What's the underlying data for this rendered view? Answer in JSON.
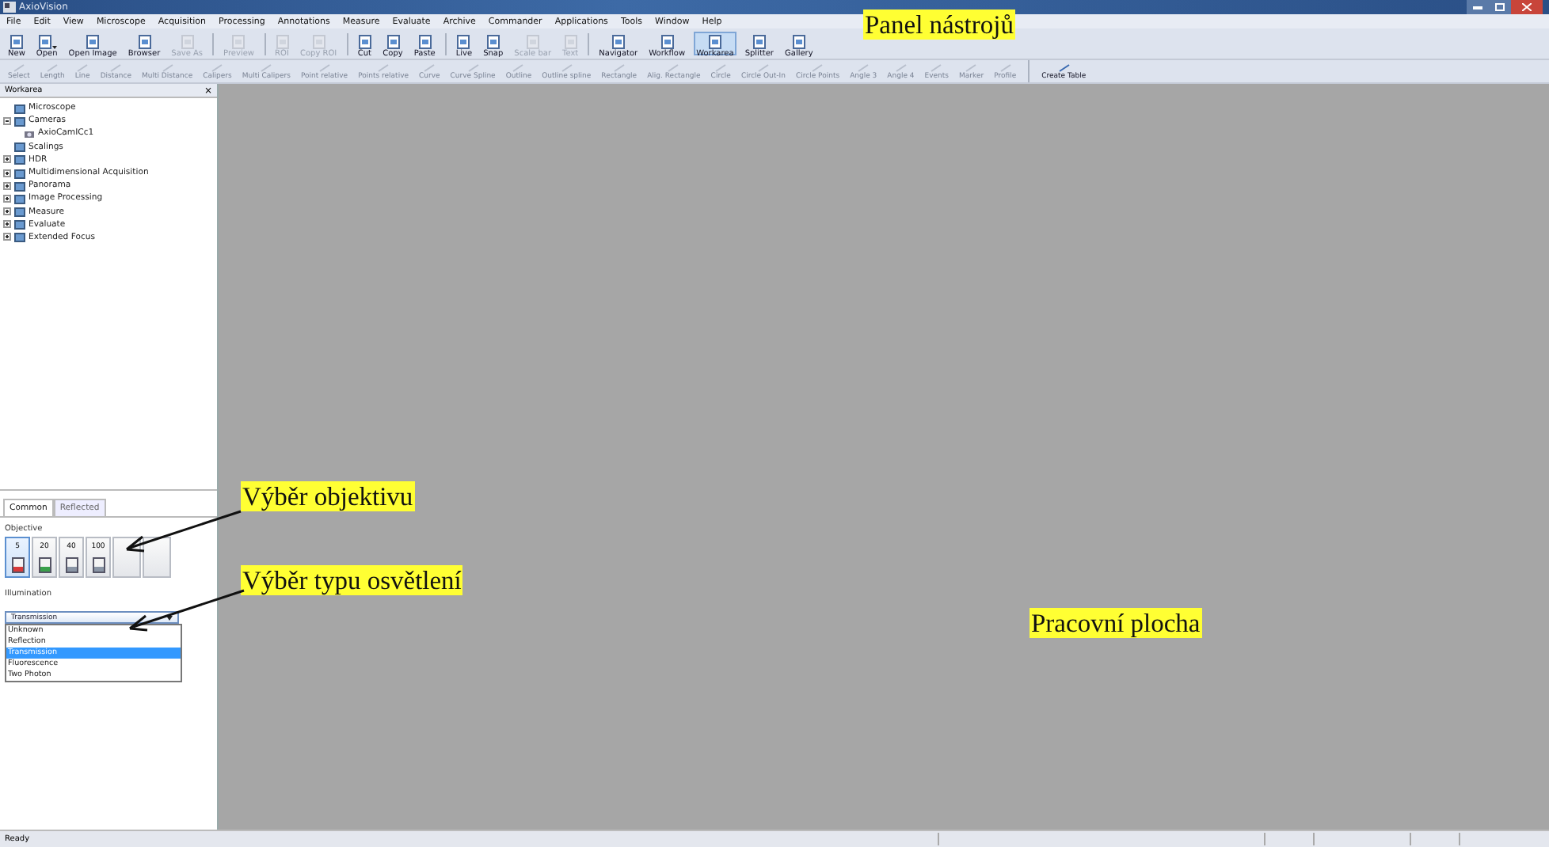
{
  "window": {
    "title": "AxioVision"
  },
  "menu": [
    "File",
    "Edit",
    "View",
    "Microscope",
    "Acquisition",
    "Processing",
    "Annotations",
    "Measure",
    "Evaluate",
    "Archive",
    "Commander",
    "Applications",
    "Tools",
    "Window",
    "Help"
  ],
  "toolbar": [
    {
      "kind": "button",
      "label": "New",
      "disabled": false,
      "selected": false
    },
    {
      "kind": "button",
      "label": "Open",
      "disabled": false,
      "selected": false,
      "dropdown": true
    },
    {
      "kind": "button",
      "label": "Open Image",
      "disabled": false,
      "selected": false
    },
    {
      "kind": "button",
      "label": "Browser",
      "disabled": false,
      "selected": false
    },
    {
      "kind": "button",
      "label": "Save As",
      "disabled": true,
      "selected": false
    },
    {
      "kind": "separator"
    },
    {
      "kind": "button",
      "label": "Preview",
      "disabled": true,
      "selected": false
    },
    {
      "kind": "separator"
    },
    {
      "kind": "button",
      "label": "ROI",
      "disabled": true,
      "selected": false
    },
    {
      "kind": "button",
      "label": "Copy ROI",
      "disabled": true,
      "selected": false
    },
    {
      "kind": "separator"
    },
    {
      "kind": "button",
      "label": "Cut",
      "disabled": false,
      "selected": false
    },
    {
      "kind": "button",
      "label": "Copy",
      "disabled": false,
      "selected": false
    },
    {
      "kind": "button",
      "label": "Paste",
      "disabled": false,
      "selected": false
    },
    {
      "kind": "separator"
    },
    {
      "kind": "button",
      "label": "Live",
      "disabled": false,
      "selected": false
    },
    {
      "kind": "button",
      "label": "Snap",
      "disabled": false,
      "selected": false
    },
    {
      "kind": "button",
      "label": "Scale bar",
      "disabled": true,
      "selected": false
    },
    {
      "kind": "button",
      "label": "Text",
      "disabled": true,
      "selected": false
    },
    {
      "kind": "separator"
    },
    {
      "kind": "button",
      "label": "Navigator",
      "disabled": false,
      "selected": false
    },
    {
      "kind": "button",
      "label": "Workflow",
      "disabled": false,
      "selected": false
    },
    {
      "kind": "button",
      "label": "Workarea",
      "disabled": false,
      "selected": true
    },
    {
      "kind": "button",
      "label": "Splitter",
      "disabled": false,
      "selected": false
    },
    {
      "kind": "button",
      "label": "Gallery",
      "disabled": false,
      "selected": false
    }
  ],
  "measure_toolbar": [
    {
      "kind": "button",
      "label": "Select",
      "disabled": true
    },
    {
      "kind": "button",
      "label": "Length",
      "disabled": true
    },
    {
      "kind": "button",
      "label": "Line",
      "disabled": true
    },
    {
      "kind": "button",
      "label": "Distance",
      "disabled": true
    },
    {
      "kind": "button",
      "label": "Multi Distance",
      "disabled": true
    },
    {
      "kind": "button",
      "label": "Calipers",
      "disabled": true
    },
    {
      "kind": "button",
      "label": "Multi Calipers",
      "disabled": true
    },
    {
      "kind": "button",
      "label": "Point relative",
      "disabled": true
    },
    {
      "kind": "button",
      "label": "Points relative",
      "disabled": true
    },
    {
      "kind": "button",
      "label": "Curve",
      "disabled": true
    },
    {
      "kind": "button",
      "label": "Curve Spline",
      "disabled": true
    },
    {
      "kind": "button",
      "label": "Outline",
      "disabled": true
    },
    {
      "kind": "button",
      "label": "Outline spline",
      "disabled": true
    },
    {
      "kind": "button",
      "label": "Rectangle",
      "disabled": true
    },
    {
      "kind": "button",
      "label": "Alig. Rectangle",
      "disabled": true
    },
    {
      "kind": "button",
      "label": "Circle",
      "disabled": true
    },
    {
      "kind": "button",
      "label": "Circle Out-In",
      "disabled": true
    },
    {
      "kind": "button",
      "label": "Circle Points",
      "disabled": true
    },
    {
      "kind": "button",
      "label": "Angle 3",
      "disabled": true
    },
    {
      "kind": "button",
      "label": "Angle 4",
      "disabled": true
    },
    {
      "kind": "button",
      "label": "Events",
      "disabled": true
    },
    {
      "kind": "button",
      "label": "Marker",
      "disabled": true
    },
    {
      "kind": "button",
      "label": "Profile",
      "disabled": true
    },
    {
      "kind": "separator"
    },
    {
      "kind": "button",
      "label": "Create Table",
      "disabled": false
    }
  ],
  "workarea": {
    "title": "Workarea",
    "close": "×",
    "tree": [
      {
        "label": "Microscope"
      },
      {
        "label": "Cameras",
        "expanded": true,
        "children": [
          {
            "label": "AxioCamICc1"
          }
        ]
      },
      {
        "label": "Scalings"
      },
      {
        "label": "HDR",
        "expanded": false
      },
      {
        "label": "Multidimensional Acquisition",
        "expanded": false
      },
      {
        "label": "Panorama",
        "expanded": false
      },
      {
        "label": "Image Processing",
        "expanded": false
      },
      {
        "label": "Measure",
        "expanded": false
      },
      {
        "label": "Evaluate",
        "expanded": false
      },
      {
        "label": "Extended Focus",
        "expanded": false
      }
    ],
    "tabs": [
      {
        "label": "Common",
        "selected": true
      },
      {
        "label": "Reflected",
        "selected": false
      }
    ],
    "objective": {
      "label": "Objective",
      "buttons": [
        {
          "kind": "lens",
          "label": "5",
          "selected": true,
          "color": "#d83a3a"
        },
        {
          "kind": "lens",
          "label": "20",
          "selected": false,
          "color": "#3aa04a"
        },
        {
          "kind": "lens",
          "label": "40",
          "selected": false,
          "color": "#8a95a5"
        },
        {
          "kind": "lens",
          "label": "100",
          "selected": false,
          "color": "#8a95a5"
        },
        {
          "kind": "empty"
        },
        {
          "kind": "empty"
        }
      ]
    },
    "illumination": {
      "label": "Illumination",
      "value": "Transmission",
      "options": [
        {
          "label": "Unknown",
          "selected": false
        },
        {
          "label": "Reflection",
          "selected": false
        },
        {
          "label": "Transmission",
          "selected": true
        },
        {
          "label": "Fluorescence",
          "selected": false
        },
        {
          "label": "Two Photon",
          "selected": false
        }
      ]
    }
  },
  "callouts": [
    {
      "kind": "plain",
      "text": "Panel nástrojů"
    },
    {
      "kind": "arrow",
      "text": "Výběr objektivu"
    },
    {
      "kind": "arrow",
      "text": "Výběr typu osvětlení"
    },
    {
      "kind": "plain",
      "text": "Pracovní plocha"
    }
  ],
  "status_bar": {
    "text": "Ready"
  }
}
